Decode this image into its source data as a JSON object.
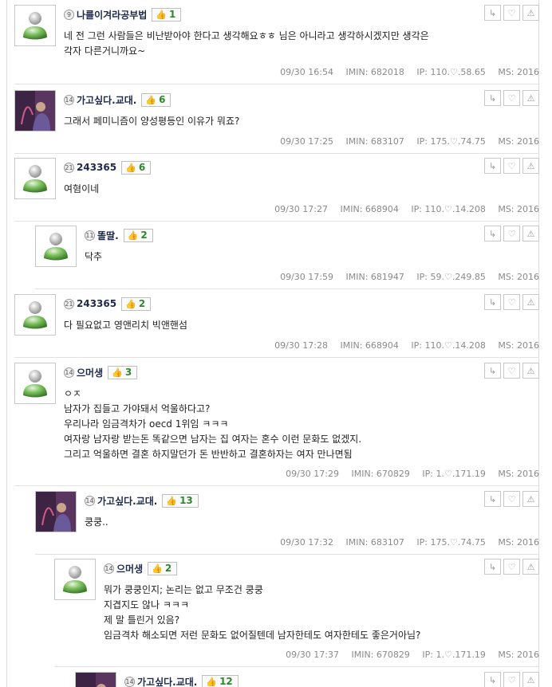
{
  "comments": [
    {
      "level": "9",
      "nick": "나를이겨라공부법",
      "likes": "1",
      "avatar": "default",
      "lines": [
        "네 전 그런 사람들은 비난받아야 한다고 생각해요ㅎㅎ 님은 아니라고 생각하시겠지만 생각은",
        "각자 다른거니까요~"
      ],
      "date": "09/30 16:54",
      "imin": "IMIN: 682018",
      "ip": "IP: 110.♡.58.65",
      "ms": "MS: 2016"
    },
    {
      "level": "14",
      "nick": "가고싶다.교대.",
      "likes": "6",
      "avatar": "purple",
      "lines": [
        "그래서 페미니즘이 양성평등인 이유가 뭐죠?"
      ],
      "date": "09/30 17:25",
      "imin": "IMIN: 683107",
      "ip": "IP: 175.♡.74.75",
      "ms": "MS: 2016"
    },
    {
      "level": "21",
      "nick": "243365",
      "likes": "6",
      "avatar": "default",
      "lines": [
        "여혐이네"
      ],
      "date": "09/30 17:27",
      "imin": "IMIN: 668904",
      "ip": "IP: 110.♡.14.208",
      "ms": "MS: 2016"
    },
    {
      "level": "11",
      "nick": "똘딸.",
      "likes": "2",
      "avatar": "default",
      "lines": [
        "닥추"
      ],
      "date": "09/30 17:59",
      "imin": "IMIN: 681947",
      "ip": "IP: 59.♡.249.85",
      "ms": "MS: 2016"
    },
    {
      "level": "21",
      "nick": "243365",
      "likes": "2",
      "avatar": "default",
      "lines": [
        "다 필요없고 영앤리치 빅앤핸섬"
      ],
      "date": "09/30 17:28",
      "imin": "IMIN: 668904",
      "ip": "IP: 110.♡.14.208",
      "ms": "MS: 2016"
    },
    {
      "level": "14",
      "nick": "으머생",
      "likes": "3",
      "avatar": "default",
      "lines": [
        "ㅇㅈ",
        "남자가 집들고 가야돼서 억울하다고?",
        "우리나라 임금격차가 oecd 1위임 ㅋㅋㅋ",
        "여자랑 남자랑 받는돈 똑같으면 남자는 집 여자는 혼수 이런 문화도 없겠지.",
        "그리고 억울하면 결혼 하지말던가 돈 반반하고 결혼하자는 여자 만나면됨"
      ],
      "date": "09/30 17:29",
      "imin": "IMIN: 670829",
      "ip": "IP: 1.♡.171.19",
      "ms": "MS: 2016"
    },
    {
      "level": "14",
      "nick": "가고싶다.교대.",
      "likes": "13",
      "avatar": "purple",
      "lines": [
        "쿵쿵.."
      ],
      "date": "09/30 17:32",
      "imin": "IMIN: 683107",
      "ip": "IP: 175.♡.74.75",
      "ms": "MS: 2016"
    },
    {
      "level": "14",
      "nick": "으머생",
      "likes": "2",
      "avatar": "default",
      "lines": [
        "뭐가 쿵쿵인지; 논리는 없고 무조건 쿵쿵",
        "지겹지도 않나 ㅋㅋㅋ",
        "제 말 틀린거 있음?",
        "임금격차 해소되면 저런 문화도 없어질텐데 남자한테도 여자한테도 좋은거아님?"
      ],
      "date": "09/30 17:37",
      "imin": "IMIN: 670829",
      "ip": "IP: 1.♡.171.19",
      "ms": "MS: 2016"
    },
    {
      "level": "14",
      "nick": "가고싶다.교대.",
      "likes": "12",
      "avatar": "purple",
      "lines": [],
      "date": "",
      "imin": "",
      "ip": "",
      "ms": ""
    }
  ],
  "icons": {
    "reply": "reply-icon",
    "like": "heart-icon",
    "report": "siren-icon",
    "thumb": "thumbs-up-icon"
  },
  "colors": {
    "like_count": "#2c8a2c",
    "nick": "#1e2a4a",
    "meta": "#8a8a8a"
  }
}
